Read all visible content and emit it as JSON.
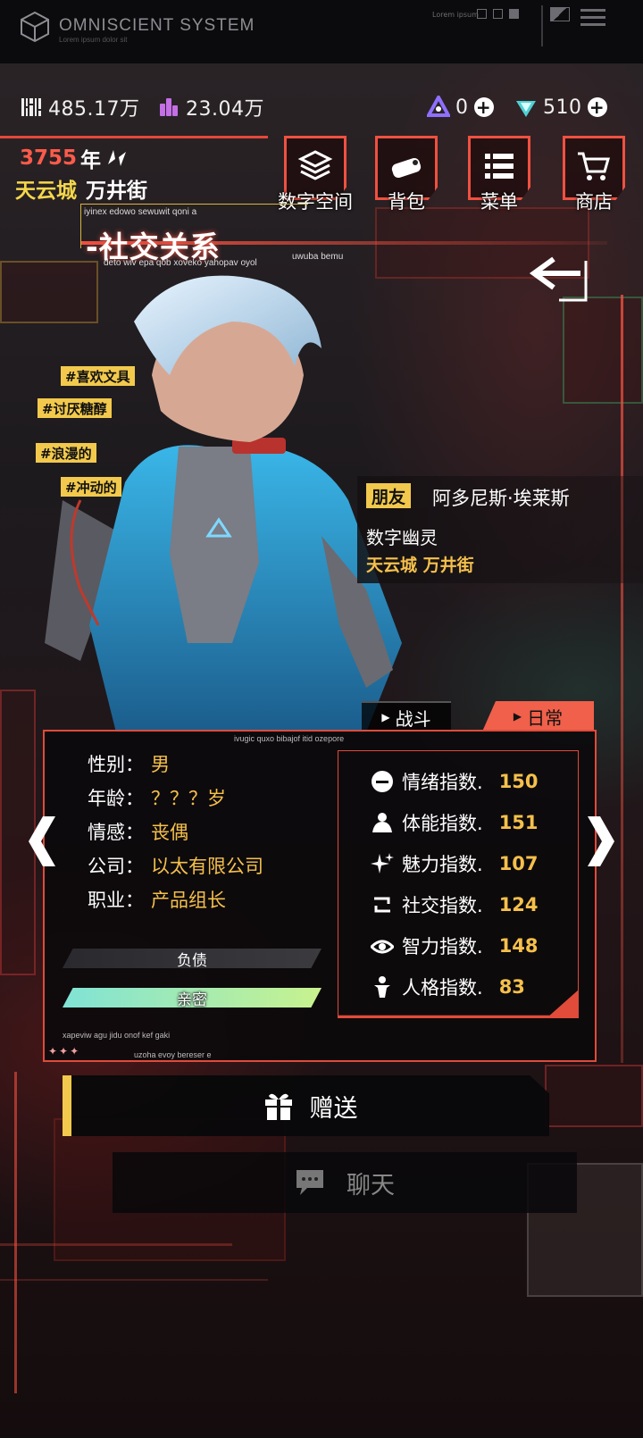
{
  "system": {
    "title": "OMNISCIENT  SYSTEM",
    "subtitle": "Lorem ipsum dolor sit",
    "lorem": "Lorem ipsum"
  },
  "currencies": {
    "c1": "485.17万",
    "c2": "23.04万",
    "c3": "0",
    "c4": "510"
  },
  "world": {
    "year": "3755",
    "year_unit": "年",
    "city": "天云城",
    "street": "万井街"
  },
  "nav": [
    {
      "label": "数字空间",
      "icon": "layers-icon"
    },
    {
      "label": "背包",
      "icon": "pouch-icon"
    },
    {
      "label": "菜单",
      "icon": "menu-icon"
    },
    {
      "label": "商店",
      "icon": "cart-icon"
    }
  ],
  "page": {
    "caption_top": "iyinex edowo sewuwit qoni a",
    "title": "-社交关系",
    "caption_bottom": "deto wiv epa qob xoveko yahopav oyol",
    "caption_right": "uwuba bemu"
  },
  "tags": [
    "#喜欢文具",
    "#讨厌糖醇",
    "#浪漫的",
    "#冲动的"
  ],
  "character": {
    "relation": "朋友",
    "name": "阿多尼斯·埃莱斯",
    "role": "数字幽灵",
    "location": "天云城  万井街"
  },
  "tabs": {
    "battle": "战斗",
    "daily": "日常"
  },
  "panel": {
    "caption": "ivugic quxo bibajof itid ozepore",
    "footer1": "xapeviw agu jidu onof kef gaki",
    "footer2": "uzoha evoy bereser e",
    "stars": "✦✦✦"
  },
  "attributes": [
    {
      "key": "性别：",
      "value": "男"
    },
    {
      "key": "年龄：",
      "value": "？？？岁"
    },
    {
      "key": "情感：",
      "value": "丧偶"
    },
    {
      "key": "公司：",
      "value": "以太有限公司"
    },
    {
      "key": "职业：",
      "value": "产品组长"
    }
  ],
  "bars": {
    "debt": "负债",
    "intimacy": "亲密"
  },
  "stats": [
    {
      "label": "情绪指数.",
      "value": "150",
      "icon": "mood-icon"
    },
    {
      "label": "体能指数.",
      "value": "151",
      "icon": "stamina-icon"
    },
    {
      "label": "魅力指数.",
      "value": "107",
      "icon": "sparkle-icon"
    },
    {
      "label": "社交指数.",
      "value": "124",
      "icon": "social-icon"
    },
    {
      "label": "智力指数.",
      "value": "148",
      "icon": "eye-icon"
    },
    {
      "label": "人格指数.",
      "value": "83",
      "icon": "person-icon"
    }
  ],
  "actions": {
    "gift": "赠送",
    "chat": "聊天"
  },
  "colors": {
    "accent_red": "#f0504a",
    "accent_yellow": "#f2c94c",
    "stat_value": "#f5c04b"
  }
}
